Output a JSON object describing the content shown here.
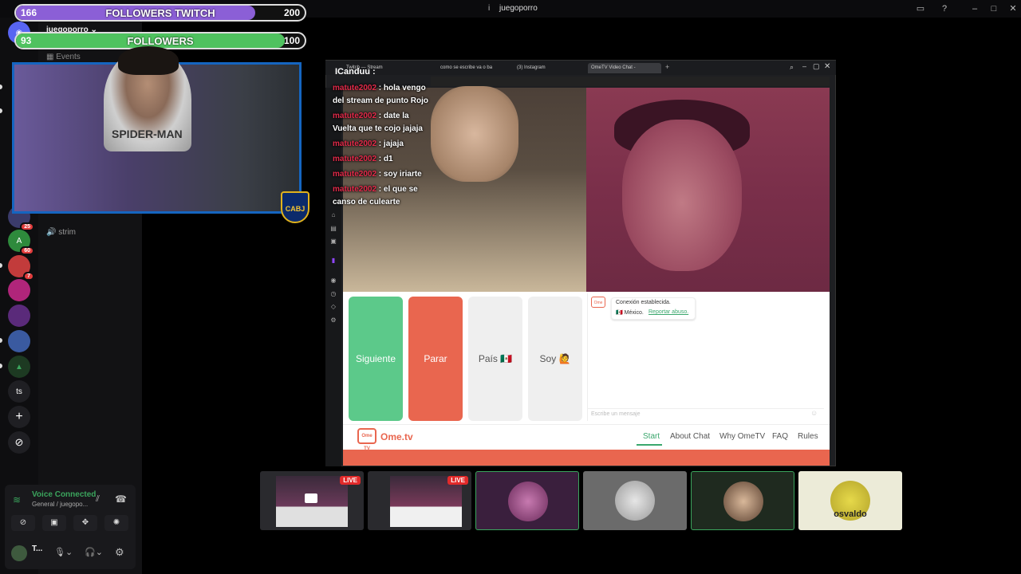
{
  "window": {
    "title": "juegoporro",
    "title_icon": "i"
  },
  "overlays": {
    "twitch_bar": {
      "current": "166",
      "label": "FOLLOWERS TWITCH",
      "goal": "200",
      "progress": 0.83,
      "color": "#8b5fd6"
    },
    "followers_bar": {
      "current": "93",
      "label": "FOLLOWERS",
      "goal": "100",
      "progress": 0.93,
      "color": "#4fc25f"
    },
    "webcam": {
      "shirt_text": "SPIDER-MAN",
      "shield_text": "CABJ"
    }
  },
  "discord": {
    "server_name": "juegoporro ⌄",
    "events_label": "Events",
    "voice_channel": "strim",
    "servers": [
      {
        "label": "",
        "badge": "25"
      },
      {
        "label": "A",
        "badge": "60"
      },
      {
        "label": "",
        "badge": "7"
      },
      {
        "label": "",
        "badge": ""
      },
      {
        "label": "",
        "badge": ""
      },
      {
        "label": "",
        "badge": ""
      },
      {
        "label": "",
        "badge": ""
      },
      {
        "label": "ts",
        "badge": ""
      },
      {
        "label": "+",
        "badge": ""
      },
      {
        "label": "⊘",
        "badge": ""
      }
    ],
    "voice_status": "Voice Connected",
    "voice_sub": "General / juegopo...",
    "user_name": "T..."
  },
  "browser": {
    "tabs": [
      "Twitch — Stream",
      "como se escribe va o ba",
      "(3) Instagram",
      "OmeTV Video Chat -"
    ],
    "active_tab_index": 3
  },
  "chat": {
    "header": "ICanduu :",
    "messages": [
      {
        "user": "matute2002",
        "text": "hola vengo del stream de punto Rojo"
      },
      {
        "user": "matute2002",
        "text": "date la Vuelta que te cojo jajaja"
      },
      {
        "user": "matute2002",
        "text": "jajaja"
      },
      {
        "user": "matute2002",
        "text": "d1"
      },
      {
        "user": "matute2002",
        "text": "soy iriarte"
      },
      {
        "user": "matute2002",
        "text": "el que se canso de culearte"
      }
    ]
  },
  "ometv": {
    "btn_next": "Siguiente",
    "btn_stop": "Parar",
    "btn_country": "País 🇲🇽",
    "btn_soy": "Soy 🙋",
    "conn_title": "Conexión establecida.",
    "conn_country": "🇲🇽 México.",
    "conn_report": "Reportar abuso.",
    "mini_logo": "Ome",
    "input_placeholder": "Escribe un mensaje",
    "logo_box": "Ome TV",
    "logo_text": "Ome.tv",
    "nav": [
      "Start",
      "About Chat",
      "Why OmeTV",
      "FAQ",
      "Rules"
    ]
  },
  "stream_tiles": [
    {
      "kind": "screen",
      "live": "LIVE"
    },
    {
      "kind": "screen",
      "live": "LIVE"
    },
    {
      "kind": "avatar",
      "name": ""
    },
    {
      "kind": "avatar",
      "name": ""
    },
    {
      "kind": "avatar",
      "name": ""
    },
    {
      "kind": "avatar",
      "name": "osvaldo"
    }
  ]
}
